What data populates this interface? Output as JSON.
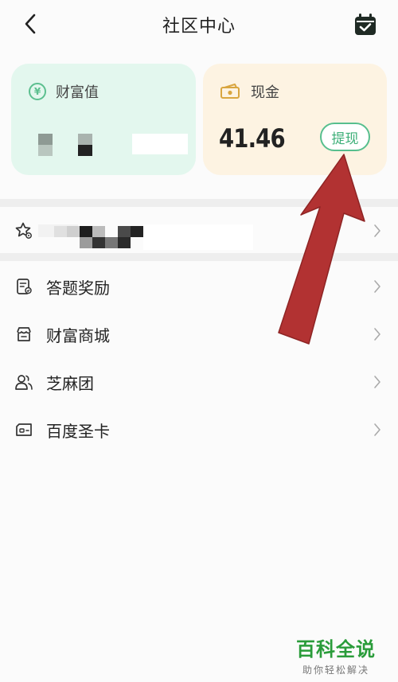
{
  "header": {
    "title": "社区中心",
    "back_icon": "chevron-left-icon",
    "calendar_icon": "calendar-check-icon"
  },
  "wealth_card": {
    "label": "财富值",
    "icon": "yen-coin-icon",
    "background": "#e3f7ee"
  },
  "cash_card": {
    "label": "现金",
    "icon": "cash-icon",
    "amount": "41.46",
    "withdraw_label": "提现",
    "background": "#fdf3e2"
  },
  "menu": {
    "items": [
      {
        "label": "答题奖励",
        "icon": "quiz-reward-icon"
      },
      {
        "label": "财富商城",
        "icon": "store-icon"
      },
      {
        "label": "芝麻团",
        "icon": "group-users-icon"
      },
      {
        "label": "百度圣卡",
        "icon": "sim-card-icon"
      }
    ],
    "first_item_icon": "star-settings-icon"
  },
  "watermark": {
    "title": "百科全说",
    "subtitle": "助你轻松解决"
  },
  "colors": {
    "accent_green": "#57bf8e",
    "arrow_red": "#b23232"
  }
}
